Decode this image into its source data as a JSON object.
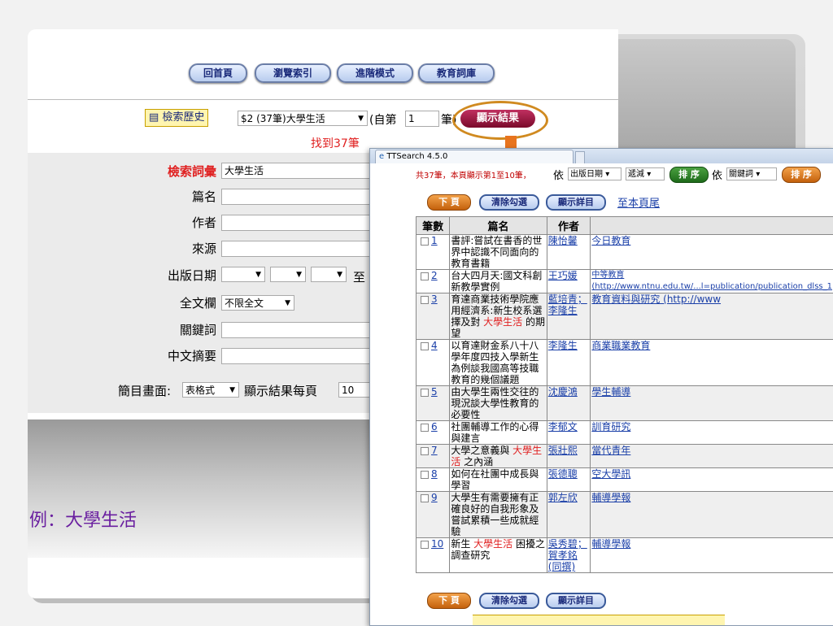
{
  "nav": {
    "home": "回首頁",
    "browse": "瀏覽索引",
    "advanced": "進階模式",
    "thesaurus": "教育詞庫"
  },
  "history": {
    "button": "檢索歷史",
    "selected": "$2 (37筆)大學生活",
    "from_prefix": "(自第",
    "from_value": "1",
    "from_suffix": "筆)",
    "show_button": "顯示結果",
    "found": "找到37筆"
  },
  "form": {
    "term_label": "檢索詞彙",
    "term_value": "大學生活",
    "title_label": "篇名",
    "author_label": "作者",
    "source_label": "來源",
    "date_label": "出版日期",
    "date_to": "至",
    "fulltext_label": "全文欄",
    "fulltext_value": "不限全文",
    "keyword_label": "關鍵詞",
    "abstract_label": "中文摘要",
    "brief_label": "簡目畫面:",
    "brief_value": "表格式",
    "per_page_label": "顯示結果每頁",
    "per_page_value": "10"
  },
  "example": "例：大學生活",
  "popup": {
    "tab": "TTSearch 4.5.0",
    "summary": "共37筆，本頁顯示第1至10筆，",
    "by1": "依",
    "sort_field": "出版日期",
    "sort_order": "遞減",
    "sort_btn": "排 序",
    "by2": "依",
    "sort_field2": "關鍵詞",
    "sort_btn2": "排 序",
    "next_btn": "下 頁",
    "clear_btn": "清除勾選",
    "detail_btn": "顯示詳目",
    "to_page": "至本頁尾",
    "table": {
      "headers": [
        "筆數",
        "篇名",
        "作者",
        ""
      ],
      "rows": [
        {
          "n": "1",
          "title": "書評:嘗試在書香的世界中認識不同面向的教育書籍",
          "author": "陳怡馨",
          "source": "今日教育"
        },
        {
          "n": "2",
          "title": "台大四月天:國文科創新教學實例",
          "author": "王巧媛",
          "source": "中等教育 (http://www.ntnu.edu.tw/...l=publication/publication_dlss_1"
        },
        {
          "n": "3",
          "title": "育達商業技術學院應用經濟系:新生校系選擇及對 大學生活 的期望",
          "author": "藍培青； 李隆生",
          "source": "教育資料與研究 (http://www"
        },
        {
          "n": "4",
          "title": "以育達財金系八十八學年度四技入學新生為例談我國高等技職教育的幾個議題",
          "author": "李隆生",
          "source": "商業職業教育"
        },
        {
          "n": "5",
          "title": "由大學生兩性交往的現況談大學性教育的必要性",
          "author": "沈慶鴻",
          "source": "學生輔導"
        },
        {
          "n": "6",
          "title": "社團輔導工作的心得與建言",
          "author": "李郁文",
          "source": "訓育研究"
        },
        {
          "n": "7",
          "title": "大學之意義與 大學生活 之內涵",
          "author": "張壯熙",
          "source": "當代青年"
        },
        {
          "n": "8",
          "title": "如何在社團中成長與學習",
          "author": "張德聰",
          "source": "空大學訊"
        },
        {
          "n": "9",
          "title": "大學生有需要擁有正確良好的自我形象及嘗試累積一些成就經驗",
          "author": "郭左欣",
          "source": "輔導學報"
        },
        {
          "n": "10",
          "title": "新生 大學生活 困擾之調查研究",
          "author": "吳秀碧； 賀孝銘(同撰)",
          "source": "輔導學報"
        }
      ]
    }
  },
  "colors": {
    "accent": "#e8741e",
    "highlight": "#e02020",
    "example": "#6a1fa0"
  }
}
